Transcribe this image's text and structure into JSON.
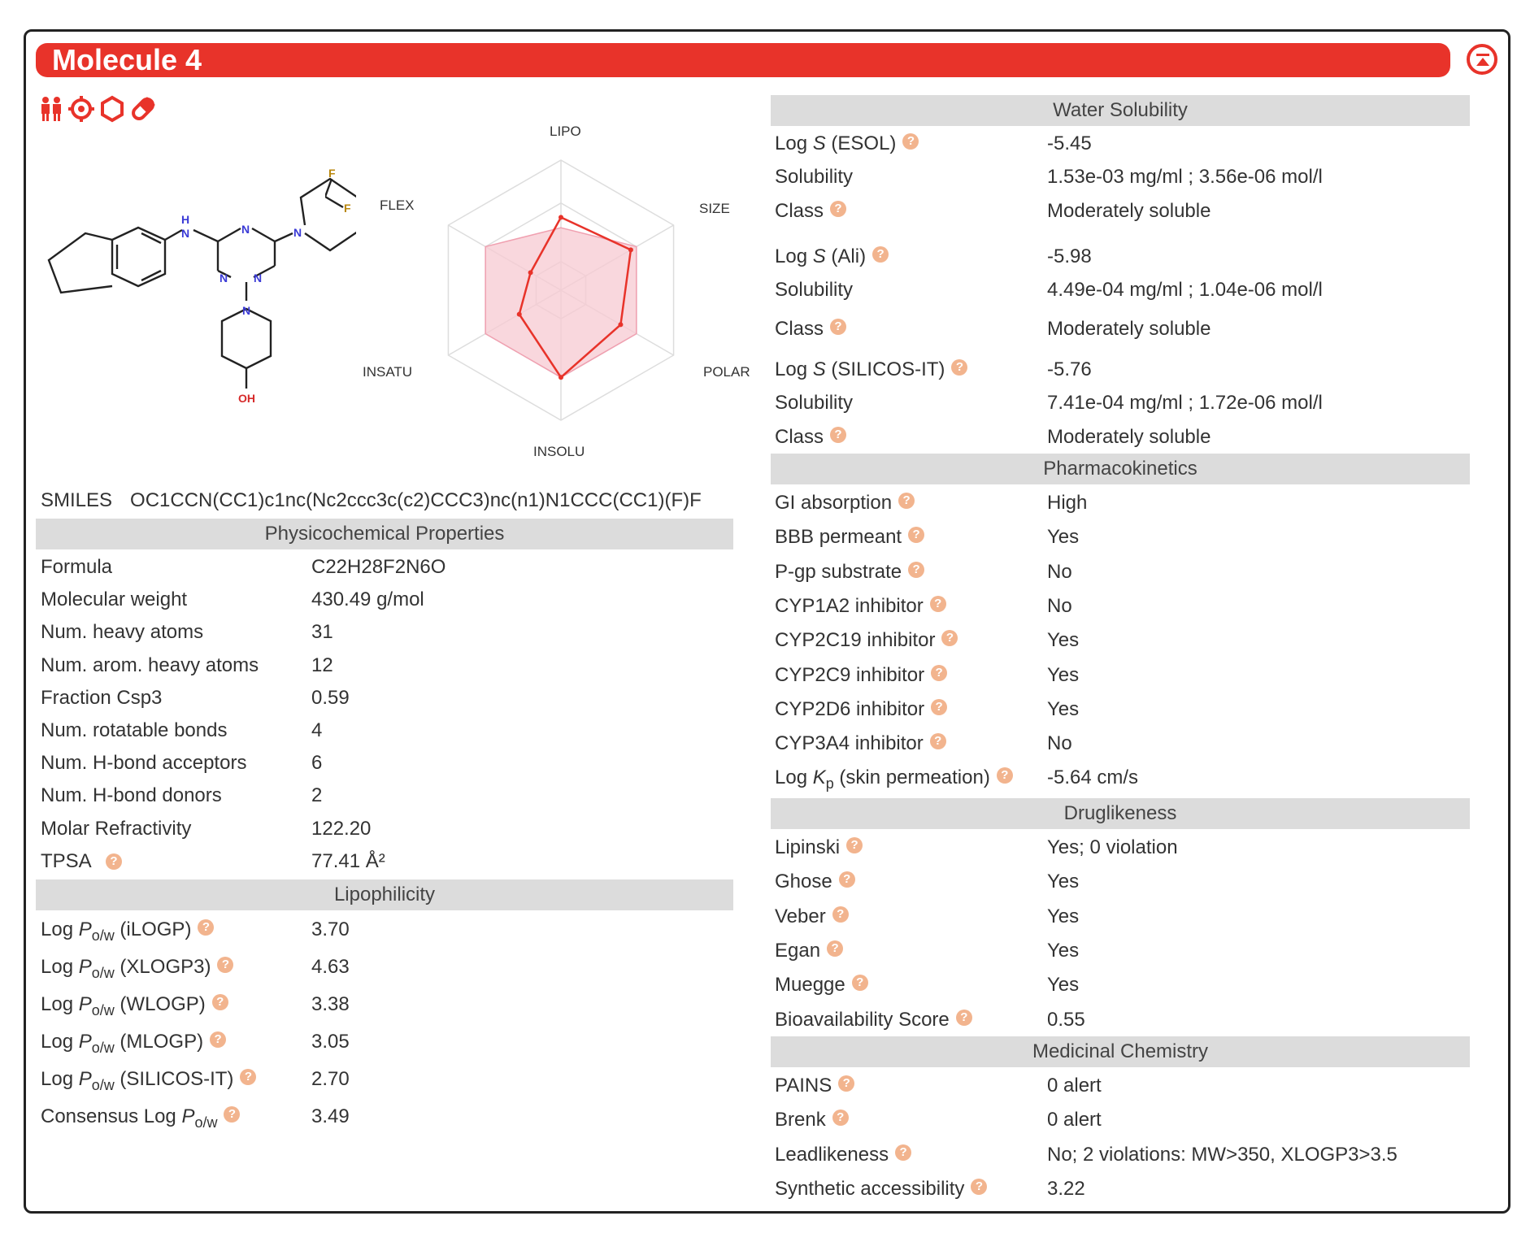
{
  "title": "Molecule 4",
  "toolbar_icons": [
    "people-icon",
    "target-icon",
    "hexagon-icon",
    "pill-icon"
  ],
  "molecule_atoms": {
    "h": "H",
    "n": "N",
    "f": "F",
    "oh": "OH"
  },
  "radar": {
    "axes": [
      "LIPO",
      "SIZE",
      "POLAR",
      "INSOLU",
      "INSATU",
      "FLEX"
    ]
  },
  "smiles": {
    "label": "SMILES",
    "value": "OC1CCN(CC1)c1nc(Nc2ccc3c(c2)CCC3)nc(n1)N1CCC(CC1)(F)F"
  },
  "physchem": {
    "header": "Physicochemical Properties",
    "rows": [
      {
        "k": "Formula",
        "v": "C22H28F2N6O"
      },
      {
        "k": "Molecular weight",
        "v": "430.49 g/mol"
      },
      {
        "k": "Num. heavy atoms",
        "v": "31"
      },
      {
        "k": "Num. arom. heavy atoms",
        "v": "12"
      },
      {
        "k": "Fraction Csp3",
        "v": "0.59"
      },
      {
        "k": "Num. rotatable bonds",
        "v": "4"
      },
      {
        "k": "Num. H-bond acceptors",
        "v": "6"
      },
      {
        "k": "Num. H-bond donors",
        "v": "2"
      },
      {
        "k": "Molar Refractivity",
        "v": "122.20"
      },
      {
        "k": "TPSA",
        "v": "77.41 Å²"
      }
    ]
  },
  "lipo": {
    "header": "Lipophilicity",
    "log": "Log",
    "p": "P",
    "sub": "o/w",
    "consensus": "Consensus Log",
    "rows": [
      {
        "method": "(iLOGP)",
        "v": "3.70"
      },
      {
        "method": "(XLOGP3)",
        "v": "4.63"
      },
      {
        "method": "(WLOGP)",
        "v": "3.38"
      },
      {
        "method": "(MLOGP)",
        "v": "3.05"
      },
      {
        "method": "(SILICOS-IT)",
        "v": "2.70"
      }
    ],
    "consensus_value": "3.49"
  },
  "water": {
    "header": "Water Solubility",
    "log": "Log",
    "s": "S",
    "solubility_label": "Solubility",
    "class_label": "Class",
    "groups": [
      {
        "method": "(ESOL)",
        "logs": "-5.45",
        "solubility": "1.53e-03 mg/ml ; 3.56e-06 mol/l",
        "class": "Moderately soluble"
      },
      {
        "method": "(Ali)",
        "logs": "-5.98",
        "solubility": "4.49e-04 mg/ml ; 1.04e-06 mol/l",
        "class": "Moderately soluble"
      },
      {
        "method": "(SILICOS-IT)",
        "logs": "-5.76",
        "solubility": "7.41e-04 mg/ml ; 1.72e-06 mol/l",
        "class": "Moderately soluble"
      }
    ]
  },
  "pk": {
    "header": "Pharmacokinetics",
    "rows": [
      {
        "k": "GI absorption",
        "v": "High"
      },
      {
        "k": "BBB permeant",
        "v": "Yes"
      },
      {
        "k": "P-gp substrate",
        "v": "No"
      },
      {
        "k": "CYP1A2 inhibitor",
        "v": "No"
      },
      {
        "k": "CYP2C19 inhibitor",
        "v": "Yes"
      },
      {
        "k": "CYP2C9 inhibitor",
        "v": "Yes"
      },
      {
        "k": "CYP2D6 inhibitor",
        "v": "Yes"
      },
      {
        "k": "CYP3A4 inhibitor",
        "v": "No"
      }
    ],
    "kp_log": "Log",
    "kp_k": "K",
    "kp_sub": "p",
    "kp_rest": "(skin permeation)",
    "kp_value": "-5.64 cm/s"
  },
  "drug": {
    "header": "Druglikeness",
    "rows": [
      {
        "k": "Lipinski",
        "v": "Yes; 0 violation"
      },
      {
        "k": "Ghose",
        "v": "Yes"
      },
      {
        "k": "Veber",
        "v": "Yes"
      },
      {
        "k": "Egan",
        "v": "Yes"
      },
      {
        "k": "Muegge",
        "v": "Yes"
      },
      {
        "k": "Bioavailability Score",
        "v": "0.55"
      }
    ]
  },
  "medchem": {
    "header": "Medicinal Chemistry",
    "rows": [
      {
        "k": "PAINS",
        "v": "0 alert"
      },
      {
        "k": "Brenk",
        "v": "0 alert"
      },
      {
        "k": "Leadlikeness",
        "v": "No; 2 violations: MW>350, XLOGP3>3.5"
      },
      {
        "k": "Synthetic accessibility",
        "v": "3.22"
      }
    ]
  },
  "colors": {
    "brand": "#e8332a",
    "header_bg": "#dcdcdc",
    "help": "#f2b48e",
    "radar_fill": "#f7c9d2",
    "radar_line": "#e8332a"
  }
}
